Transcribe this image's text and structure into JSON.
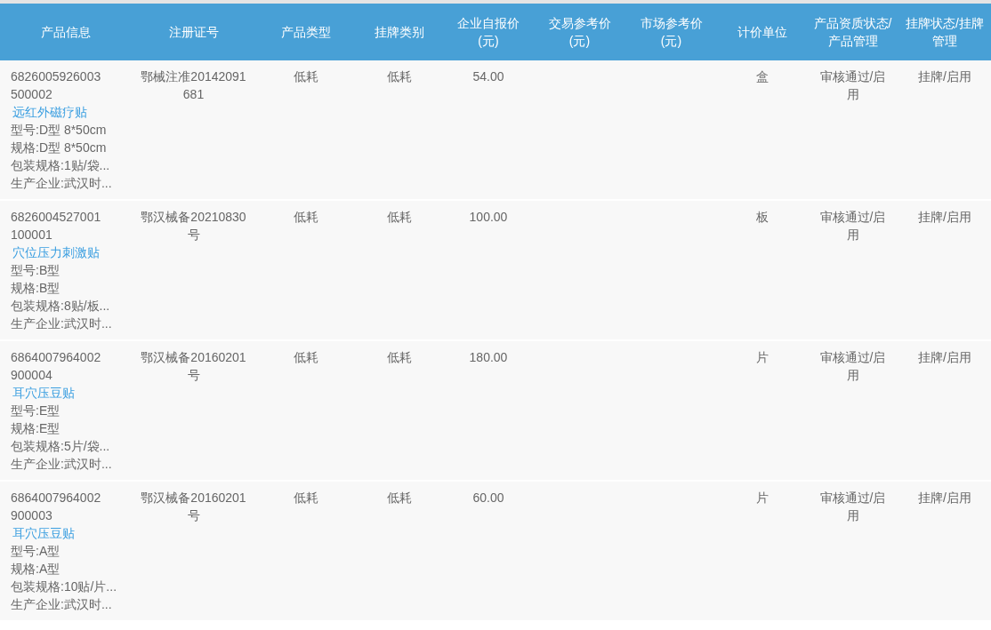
{
  "table": {
    "columns": [
      {
        "label": "产品信息"
      },
      {
        "label": "注册证号"
      },
      {
        "label": "产品类型"
      },
      {
        "label": "挂牌类别"
      },
      {
        "label": "企业自报价(元)"
      },
      {
        "label": "交易参考价(元)"
      },
      {
        "label": "市场参考价(元)"
      },
      {
        "label": "计价单位"
      },
      {
        "label": "产品资质状态/产品管理"
      },
      {
        "label": "挂牌状态/挂牌管理"
      }
    ],
    "rows": [
      {
        "code": "6826005926003500002",
        "name": "远红外磁疗贴",
        "details": [
          "型号:D型 8*50cm",
          "规格:D型 8*50cm",
          "包装规格:1贴/袋...",
          "生产企业:武汉时..."
        ],
        "registration": "鄂械注准20142091681",
        "product_type": "低耗",
        "listing_category": "低耗",
        "self_price": "54.00",
        "unit": "盒",
        "qualification": "审核通过/启用",
        "listing_status": "挂牌/启用"
      },
      {
        "code": "6826004527001100001",
        "name": "穴位压力刺激贴",
        "details": [
          "型号:B型",
          "规格:B型",
          "包装规格:8贴/板...",
          "生产企业:武汉时..."
        ],
        "registration": "鄂汉械备20210830号",
        "product_type": "低耗",
        "listing_category": "低耗",
        "self_price": "100.00",
        "unit": "板",
        "qualification": "审核通过/启用",
        "listing_status": "挂牌/启用"
      },
      {
        "code": "6864007964002900004",
        "name": "耳穴压豆贴",
        "details": [
          "型号:E型",
          "规格:E型",
          "包装规格:5片/袋...",
          "生产企业:武汉时..."
        ],
        "registration": "鄂汉械备20160201号",
        "product_type": "低耗",
        "listing_category": "低耗",
        "self_price": "180.00",
        "unit": "片",
        "qualification": "审核通过/启用",
        "listing_status": "挂牌/启用"
      },
      {
        "code": "6864007964002900003",
        "name": "耳穴压豆贴",
        "details": [
          "型号:A型",
          "规格:A型",
          "包装规格:10贴/片...",
          "生产企业:武汉时..."
        ],
        "registration": "鄂汉械备20160201号",
        "product_type": "低耗",
        "listing_category": "低耗",
        "self_price": "60.00",
        "unit": "片",
        "qualification": "审核通过/启用",
        "listing_status": "挂牌/启用"
      }
    ]
  }
}
